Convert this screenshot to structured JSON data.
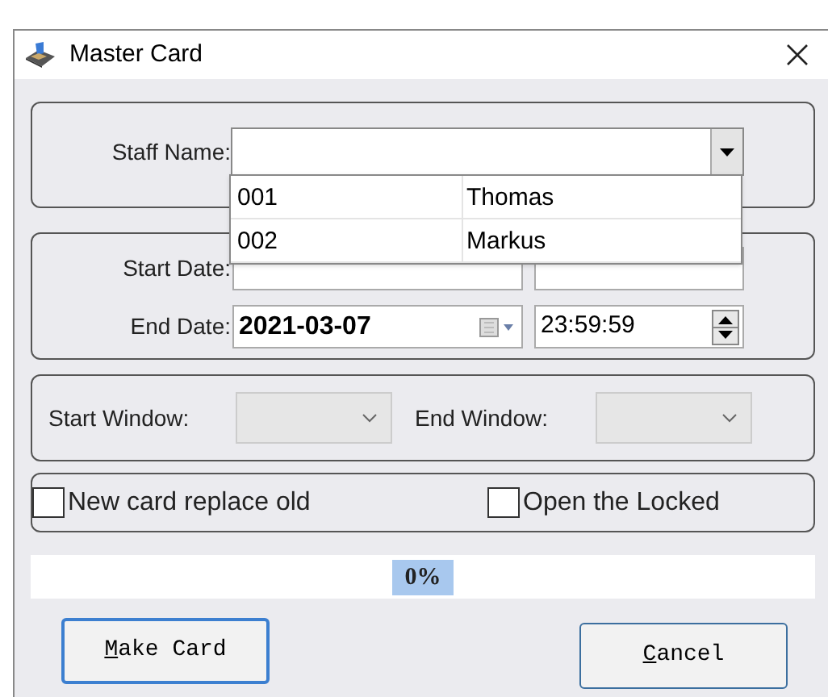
{
  "window": {
    "title": "Master Card"
  },
  "staff": {
    "label": "Staff Name:",
    "expanded": true,
    "options": [
      {
        "code": "001",
        "name": "Thomas"
      },
      {
        "code": "002",
        "name": "Markus"
      }
    ]
  },
  "start_date": {
    "label": "Start Date:"
  },
  "end_date": {
    "label": "End Date:",
    "date": "2021-03-07",
    "time": "23:59:59"
  },
  "start_window": {
    "label": "Start Window:",
    "disabled": true
  },
  "end_window": {
    "label": "End Window:",
    "disabled": true
  },
  "options": [
    {
      "label": "New card replace old",
      "checked": false
    },
    {
      "label": "Open the Locked",
      "checked": false
    }
  ],
  "progress": {
    "level": 0,
    "label": "0%"
  },
  "buttons": [
    {
      "label": "Make Card",
      "default": true
    },
    {
      "label": "Cancel",
      "default": false
    }
  ]
}
